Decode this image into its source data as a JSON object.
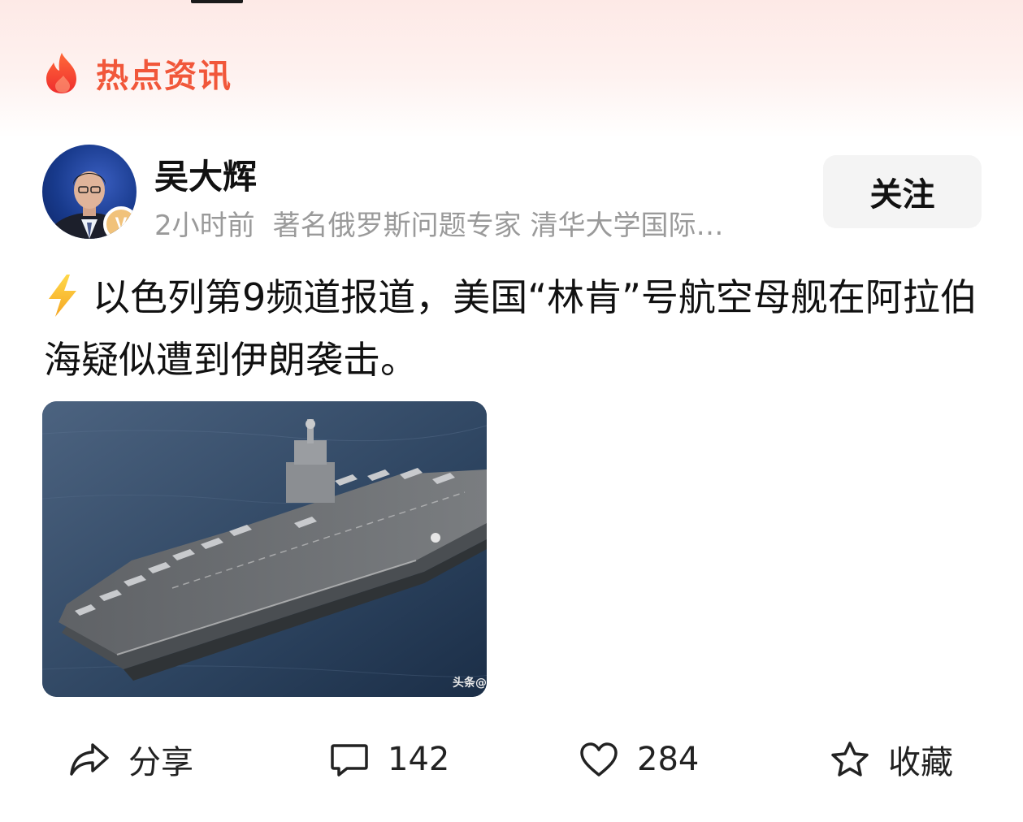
{
  "section_header": {
    "title": "热点资讯",
    "icon": "flame-icon"
  },
  "author": {
    "name": "吴大辉",
    "time": "2小时前",
    "description": "著名俄罗斯问题专家 清华大学国际…",
    "badge": "V",
    "follow_label": "关注"
  },
  "post": {
    "text": "以色列第9频道报道，美国“林肯”号航空母舰在阿拉伯海疑似遭到伊朗袭击。",
    "lead_icon": "lightning-icon",
    "image_watermark": "头条@"
  },
  "actions": {
    "share_label": "分享",
    "comment_count": "142",
    "like_count": "284",
    "favorite_label": "收藏"
  },
  "colors": {
    "accent": "#f1573a",
    "meta_gray": "#9a9a9a",
    "follow_bg": "#f4f4f4",
    "badge": "#f1c27a"
  }
}
